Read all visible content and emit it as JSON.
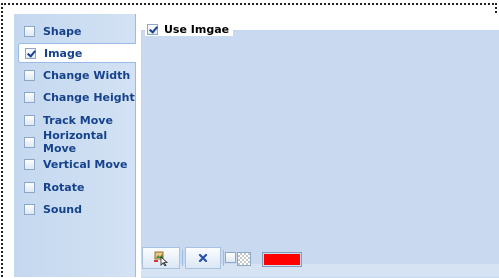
{
  "sidebar": {
    "items": [
      {
        "label": "Shape",
        "checked": false,
        "selected": false
      },
      {
        "label": "Image",
        "checked": true,
        "selected": true
      },
      {
        "label": "Change Width",
        "checked": false,
        "selected": false
      },
      {
        "label": "Change Height",
        "checked": false,
        "selected": false
      },
      {
        "label": "Track Move",
        "checked": false,
        "selected": false
      },
      {
        "label": "Horizontal Move",
        "checked": false,
        "selected": false
      },
      {
        "label": "Vertical Move",
        "checked": false,
        "selected": false
      },
      {
        "label": "Rotate",
        "checked": false,
        "selected": false
      },
      {
        "label": "Sound",
        "checked": false,
        "selected": false
      }
    ]
  },
  "image_panel": {
    "use_image_label": "Use Imgae",
    "use_image_checked": true
  },
  "toolbar": {
    "select_icon": "image-pick-icon",
    "delete_icon": "delete-x-icon",
    "transparent_checked": false,
    "color": "#ff0000"
  }
}
